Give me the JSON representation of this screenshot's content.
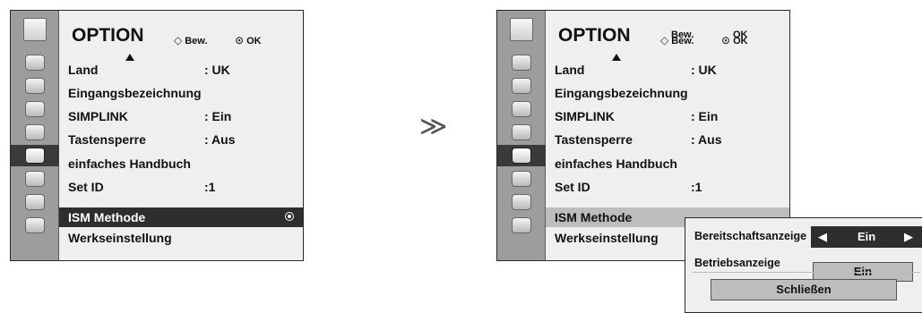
{
  "transition_symbol": "≫",
  "left_menu": {
    "title": "OPTION",
    "hint_move": "Bew.",
    "hint_ok": "OK",
    "items": [
      {
        "label": "Land",
        "value": ": UK"
      },
      {
        "label": "Eingangsbezeichnung",
        "value": ""
      },
      {
        "label": "SIMPLINK",
        "value": ": Ein"
      },
      {
        "label": "Tastensperre",
        "value": ": Aus"
      },
      {
        "label": "einfaches Handbuch",
        "value": ""
      },
      {
        "label": "Set ID",
        "value": ":1"
      },
      {
        "label": "ISM Methode",
        "value": ""
      },
      {
        "label": "Werkseinstellung",
        "value": ""
      }
    ]
  },
  "right_menu": {
    "title": "OPTION",
    "hint_move": "Bew.",
    "hint_ok": "OK",
    "hint_move_overlay": "Bew.",
    "hint_ok_overlay": "OK",
    "items": [
      {
        "label": "Land",
        "value": ": UK"
      },
      {
        "label": "Eingangsbezeichnung",
        "value": ""
      },
      {
        "label": "SIMPLINK",
        "value": ": Ein"
      },
      {
        "label": "Tastensperre",
        "value": ": Aus"
      },
      {
        "label": "einfaches Handbuch",
        "value": ""
      },
      {
        "label": "Set ID",
        "value": ":1"
      },
      {
        "label": "ISM Methode",
        "value": ""
      },
      {
        "label": "Werkseinstellung",
        "value": ""
      }
    ]
  },
  "popup": {
    "standby_label": "Bereitschaftsanzeige",
    "standby_value": "Ein",
    "operation_label": "Betriebsanzeige",
    "operation_value": "Ein",
    "close_label": "Schließen"
  }
}
